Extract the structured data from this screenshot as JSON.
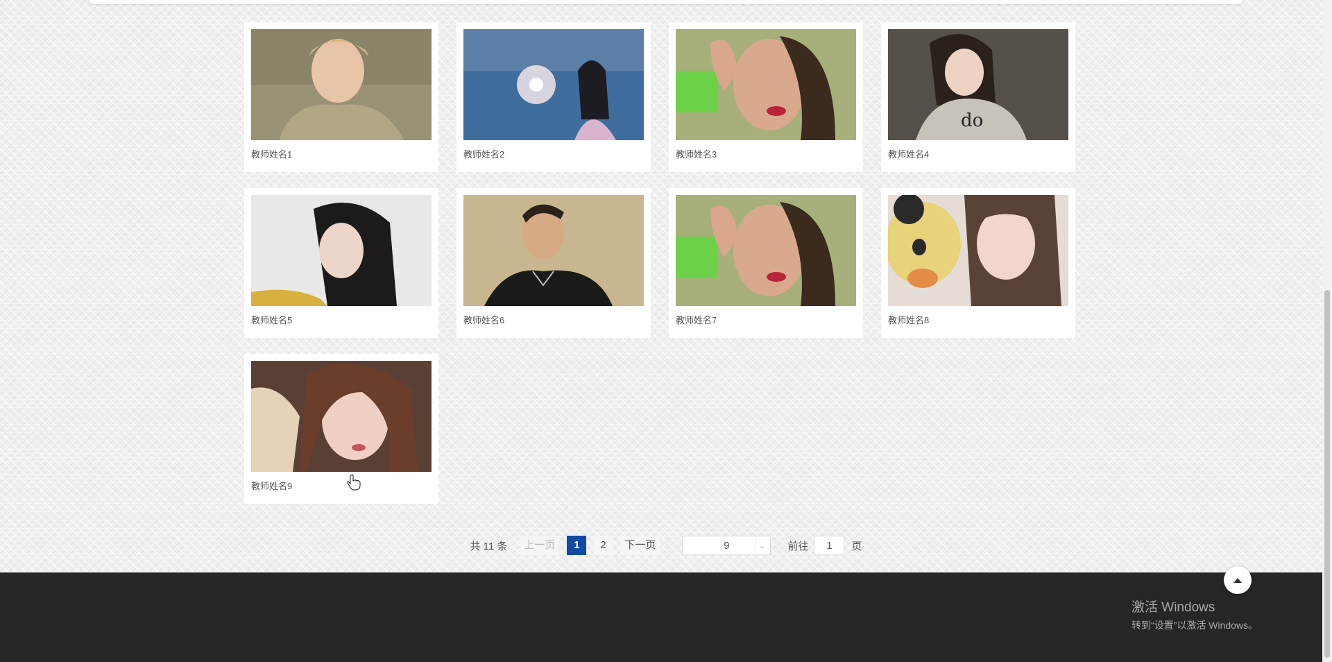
{
  "teachers": [
    {
      "name": "教师姓名1"
    },
    {
      "name": "教师姓名2"
    },
    {
      "name": "教师姓名3"
    },
    {
      "name": "教师姓名4"
    },
    {
      "name": "教师姓名5"
    },
    {
      "name": "教师姓名6"
    },
    {
      "name": "教师姓名7"
    },
    {
      "name": "教师姓名8"
    },
    {
      "name": "教师姓名9"
    }
  ],
  "pagination": {
    "total": "共 11 条",
    "prev": "上一页",
    "pages": [
      "1",
      "2"
    ],
    "current": "1",
    "next": "下一页",
    "page_size": "9",
    "goto_label": "前往",
    "goto_value": "1",
    "page_unit": "页"
  },
  "watermark": {
    "line1": "激活 Windows",
    "line2": "转到“设置”以激活 Windows。"
  },
  "icons": {
    "back_to_top": "caret-up-icon",
    "dropdown": "chevron-down-icon",
    "cursor": "hand-pointer-icon"
  },
  "colors": {
    "active_page": "#0f4aa3",
    "footer": "#262626"
  }
}
